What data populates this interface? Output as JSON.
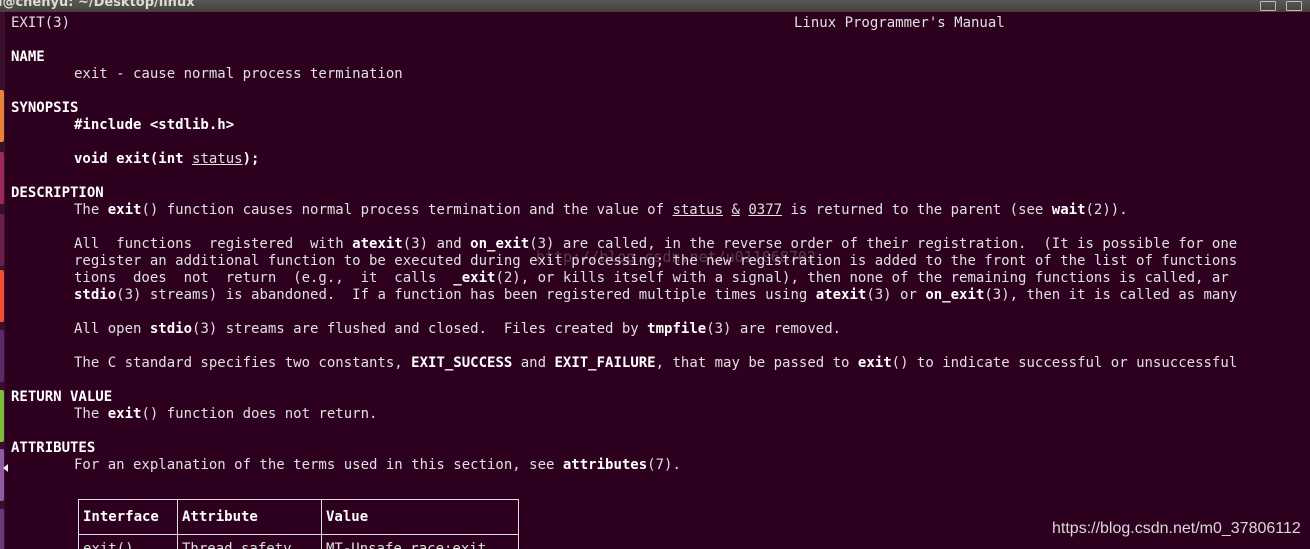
{
  "window": {
    "title": "l@chenyu: ~/Desktop/linux"
  },
  "man": {
    "header_left": "EXIT(3)",
    "header_center": "Linux Programmer's Manual",
    "name": {
      "heading": "NAME",
      "text": "exit - cause normal process termination"
    },
    "synopsis": {
      "heading": "SYNOPSIS",
      "include": "#include <stdlib.h>",
      "decl_prefix": "void exit(int ",
      "decl_param": "status",
      "decl_suffix": ");"
    },
    "description": {
      "heading": "DESCRIPTION",
      "p1": [
        "The ",
        "exit",
        "() function causes normal process termination and the value of ",
        "status",
        " ",
        "&",
        " ",
        "0377",
        " is returned to the parent (see ",
        "wait",
        "(2))."
      ],
      "p2_l1": [
        "All  functions  registered  with ",
        "atexit",
        "(3) and ",
        "on_exit",
        "(3) are called, in the reverse order of their registration.  (It is possible for one"
      ],
      "p2_l2": "register an additional function to be executed during exit processing; the new registration is added to the front of the list of functions",
      "p2_l3": [
        "tions  does  not  return  (e.g.,  it  calls  ",
        "_exit",
        "(2), or kills itself with a signal), then none of the remaining functions is called, ar"
      ],
      "p2_l4": [
        "stdio",
        "(3) streams) is abandoned.  If a function has been registered multiple times using ",
        "atexit",
        "(3) or ",
        "on_exit",
        "(3), then it is called as many"
      ],
      "p3": [
        "All open ",
        "stdio",
        "(3) streams are flushed and closed.  Files created by ",
        "tmpfile",
        "(3) are removed."
      ],
      "p4": [
        "The C standard specifies two constants, ",
        "EXIT_SUCCESS",
        " and ",
        "EXIT_FAILURE",
        ", that may be passed to ",
        "exit",
        "() to indicate successful or unsuccessful"
      ]
    },
    "return_value": {
      "heading": "RETURN VALUE",
      "text": [
        "The ",
        "exit",
        "() function does not return."
      ]
    },
    "attributes": {
      "heading": "ATTRIBUTES",
      "text": [
        "For an explanation of the terms used in this section, see ",
        "attributes",
        "(7)."
      ],
      "table": {
        "headers": [
          "Interface",
          "Attribute",
          "Value"
        ],
        "row": [
          "exit()",
          "Thread safety",
          "MT-Unsafe race:exit"
        ]
      }
    }
  },
  "watermarks": {
    "center": "http://blog.csdn.net/u011068702",
    "corner": "https://blog.csdn.net/m0_37806112"
  },
  "launcher_colors": [
    "#e8813a",
    "#d76236",
    "#f04c36",
    "#4aa3a0",
    "#7bbd3b",
    "#8e5aa0",
    "#a0a0a0"
  ]
}
